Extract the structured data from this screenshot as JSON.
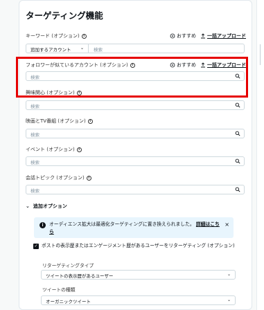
{
  "title": "ターゲティング機能",
  "actions": {
    "recommend_label": "おすすめ",
    "upload_label": "一括アップロード"
  },
  "keywords": {
    "label": "キーワード (オプション)",
    "dropdown_value": "追加するアカウント",
    "placeholder": "検索"
  },
  "follower_lookalikes": {
    "label": "フォロワーが似ているアカウント (オプション)",
    "placeholder": "検索"
  },
  "interests": {
    "label": "興味関心 (オプション)",
    "placeholder": "検索"
  },
  "movies_tv": {
    "label": "映画とTV番組 (オプション)",
    "placeholder": "検索"
  },
  "events": {
    "label": "イベント (オプション)",
    "placeholder": "検索"
  },
  "conversation_topics": {
    "label": "会話トピック (オプション)",
    "placeholder": "検索"
  },
  "additional_options": {
    "label": "追加オプション",
    "notice_text": "オーディエンス拡大は最適化ターゲティングに置き換えられました。",
    "notice_link": "詳細はこちら",
    "retarget_checkbox_label": "ポストの表示歴またはエンゲージメント歴があるユーザーをリターゲティング (オプション)",
    "retargeting_type_label": "リターゲティングタイプ",
    "retargeting_type_value": "ツイートの表示歴があるユーザー",
    "tweet_type_label": "ツイートの種類",
    "tweet_type_value": "オーガニックツイート"
  },
  "colors": {
    "highlight_border": "#e60000",
    "notice_bg": "#e8f5fd"
  }
}
